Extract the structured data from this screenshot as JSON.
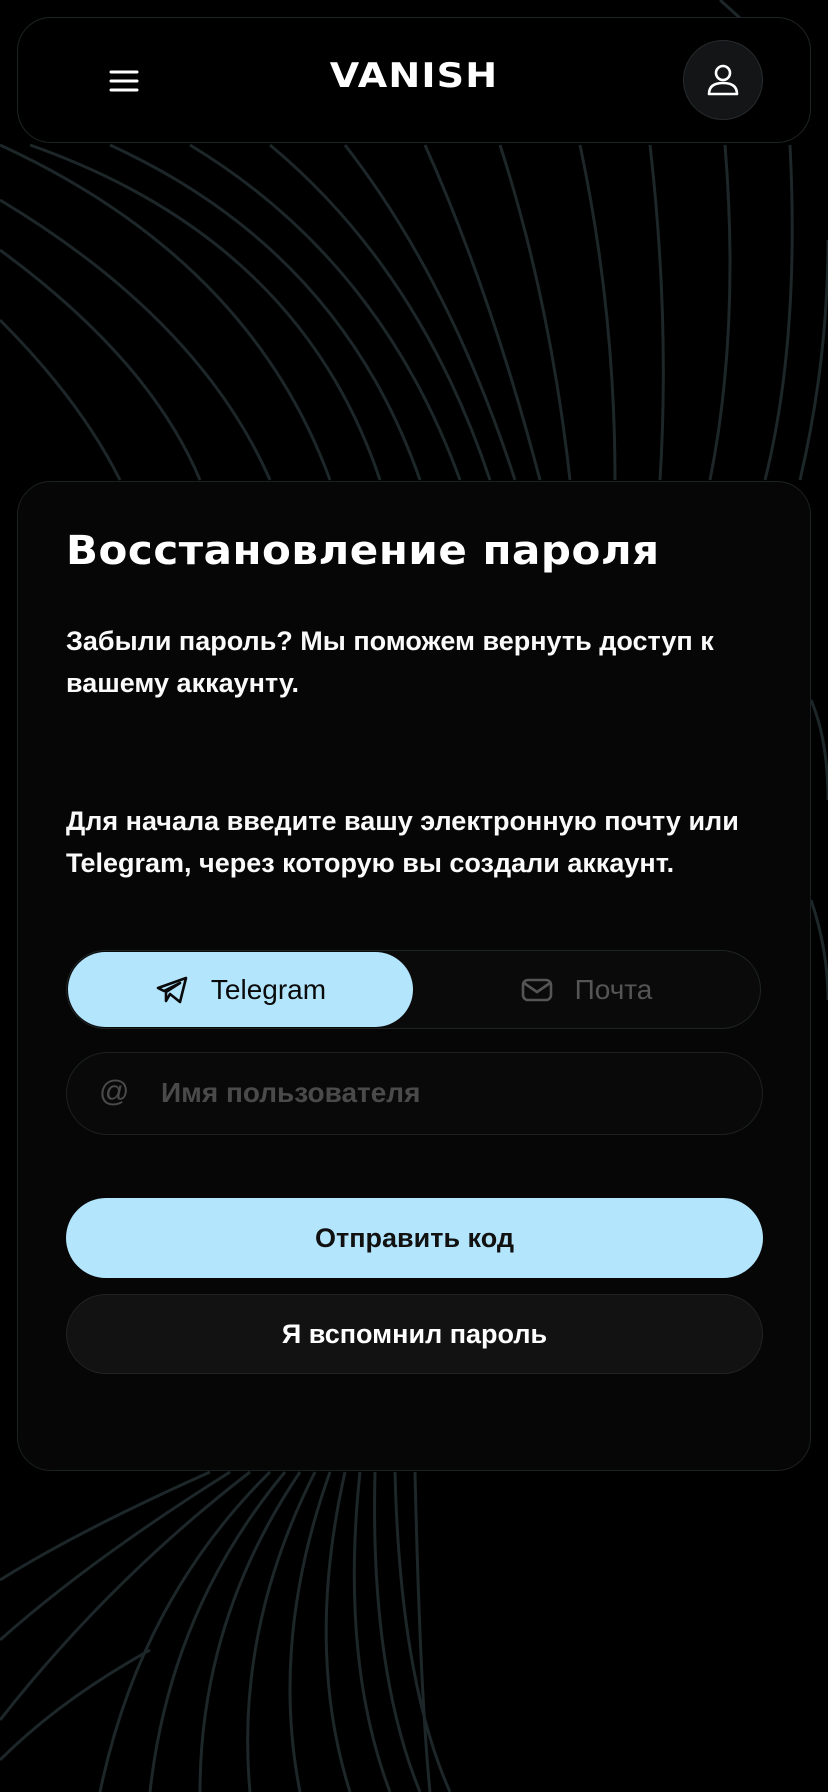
{
  "header": {
    "menu_icon": "hamburger-menu-icon",
    "logo": "VANISH",
    "profile_icon": "user-icon"
  },
  "card": {
    "title": "Восстановление пароля",
    "intro": "Забыли пароль? Мы поможем вернуть доступ к вашему аккаунту.",
    "instruction": "Для начала введите вашу электронную почту или Telegram, через которую вы создали аккаунт."
  },
  "tabs": [
    {
      "label": "Telegram",
      "icon": "telegram-icon",
      "active": true
    },
    {
      "label": "Почта",
      "icon": "mail-icon",
      "active": false
    }
  ],
  "username_input": {
    "icon": "at-icon",
    "prefix": "@",
    "placeholder": "Имя пользователя",
    "value": ""
  },
  "buttons": {
    "send_code": "Отправить код",
    "remember": "Я вспомнил пароль"
  },
  "colors": {
    "accent": "#b3e5fd",
    "background": "#000000",
    "card": "#060606",
    "lines": "#1d2628"
  }
}
